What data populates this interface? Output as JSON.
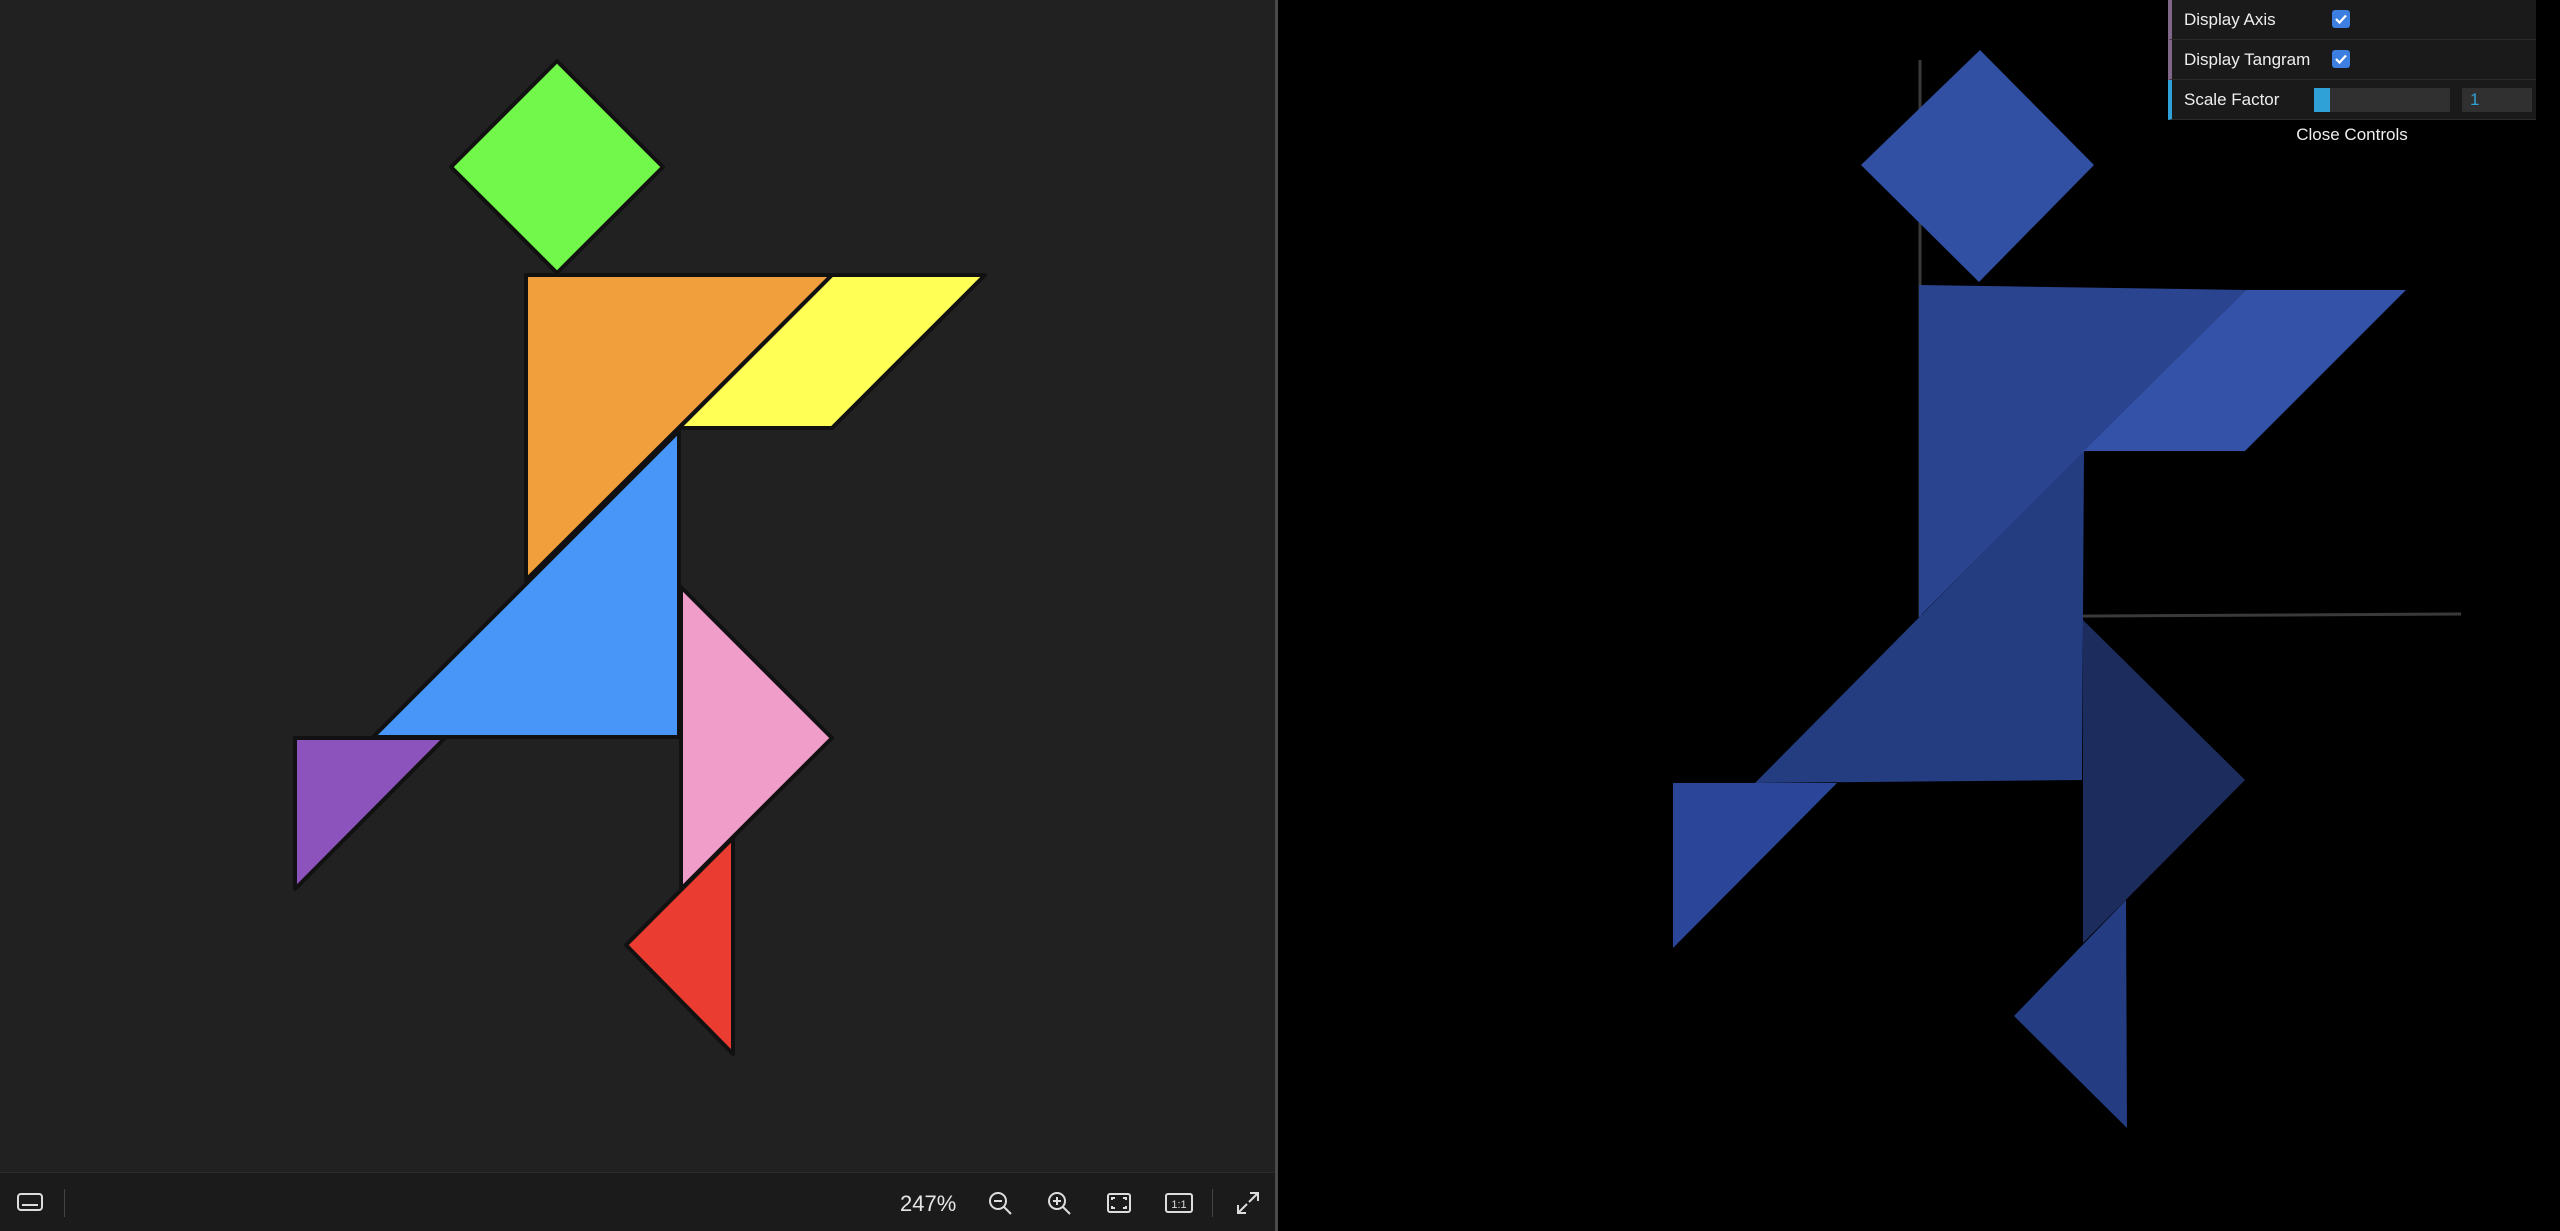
{
  "viewer": {
    "zoom_label": "247%",
    "icons": {
      "subtitle": "subtitle-icon",
      "zoom_out": "zoom-out-icon",
      "zoom_in": "zoom-in-icon",
      "fit": "fit-to-window-icon",
      "actual_size": "actual-size-icon",
      "fullscreen": "expand-icon"
    }
  },
  "tangram_colors": {
    "head": "#72f84a",
    "large_triangle_top": "#f19e3c",
    "parallelogram": "#ffff55",
    "large_triangle_bottom": "#4896f8",
    "medium_triangle": "#f09dc9",
    "small_triangle_left": "#8c53bc",
    "small_triangle_bottom": "#ea3c30"
  },
  "scene": {
    "shape_color": "#2f4fa0",
    "background": "#000000"
  },
  "controls": {
    "display_axis_label": "Display Axis",
    "display_axis_checked": true,
    "display_tangram_label": "Display Tangram",
    "display_tangram_checked": true,
    "scale_factor_label": "Scale Factor",
    "scale_factor_value": "1",
    "scale_factor_fraction": 0.12,
    "close_label": "Close Controls"
  }
}
